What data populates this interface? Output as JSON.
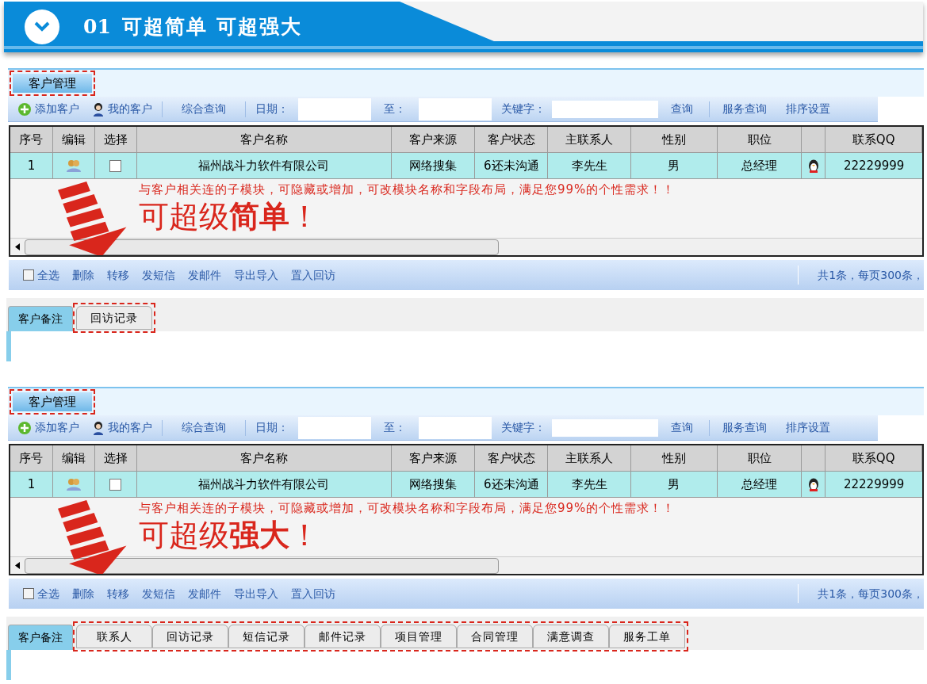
{
  "banner": {
    "number": "01",
    "title": "可超简单 可超强大"
  },
  "panels": [
    {
      "module_tab": {
        "label": "客户管理",
        "selected": true
      },
      "toolbar": {
        "add": "添加客户",
        "mine": "我的客户",
        "search_all": "综合查询",
        "date_label": "日期：",
        "to_label": "至：",
        "keyword_label": "关键字：",
        "query": "查询",
        "service_query": "服务查询",
        "sort_settings": "排序设置"
      },
      "table": {
        "columns": [
          "序号",
          "编辑",
          "选择",
          "客户名称",
          "客户来源",
          "客户状态",
          "主联系人",
          "性别",
          "职位",
          "",
          "联系QQ"
        ],
        "rows": [
          {
            "index": "1",
            "checked": false,
            "name": "福州战斗力软件有限公司",
            "source": "网络搜集",
            "status": "6还未沟通",
            "contact": "李先生",
            "gender": "男",
            "position": "总经理",
            "qq": "22229999"
          }
        ]
      },
      "annotation": {
        "note": "与客户相关连的子模块，可隐藏或增加，可改模块名称和字段布局，满足您99%的个性需求！！",
        "slogan": "可超级**简单**！"
      },
      "footer": {
        "select_all": "全选",
        "select_all_checked": false,
        "actions": [
          "删除",
          "转移",
          "发短信",
          "发邮件",
          "导出导入",
          "置入回访"
        ],
        "paging": "共1条，每页300条，"
      },
      "subtabs": [
        {
          "label": "客户备注",
          "selected": true
        },
        {
          "label": "回访记录",
          "selected": false
        }
      ]
    },
    {
      "module_tab": {
        "label": "客户管理",
        "selected": true
      },
      "toolbar": {
        "add": "添加客户",
        "mine": "我的客户",
        "search_all": "综合查询",
        "date_label": "日期：",
        "to_label": "至：",
        "keyword_label": "关键字：",
        "query": "查询",
        "service_query": "服务查询",
        "sort_settings": "排序设置"
      },
      "table": {
        "columns": [
          "序号",
          "编辑",
          "选择",
          "客户名称",
          "客户来源",
          "客户状态",
          "主联系人",
          "性别",
          "职位",
          "",
          "联系QQ"
        ],
        "rows": [
          {
            "index": "1",
            "checked": false,
            "name": "福州战斗力软件有限公司",
            "source": "网络搜集",
            "status": "6还未沟通",
            "contact": "李先生",
            "gender": "男",
            "position": "总经理",
            "qq": "22229999"
          }
        ]
      },
      "annotation": {
        "note": "与客户相关连的子模块，可隐藏或增加，可改模块名称和字段布局，满足您99%的个性需求！！",
        "slogan": "可超级**强大**！"
      },
      "footer": {
        "select_all": "全选",
        "select_all_checked": false,
        "actions": [
          "删除",
          "转移",
          "发短信",
          "发邮件",
          "导出导入",
          "置入回访"
        ],
        "paging": "共1条，每页300条，"
      },
      "subtabs": [
        {
          "label": "客户备注",
          "selected": true
        },
        {
          "label": "联系人",
          "selected": false
        },
        {
          "label": "回访记录",
          "selected": false
        },
        {
          "label": "短信记录",
          "selected": false
        },
        {
          "label": "邮件记录",
          "selected": false
        },
        {
          "label": "项目管理",
          "selected": false
        },
        {
          "label": "合同管理",
          "selected": false
        },
        {
          "label": "满意调查",
          "selected": false
        },
        {
          "label": "服务工单",
          "selected": false
        }
      ]
    }
  ]
}
